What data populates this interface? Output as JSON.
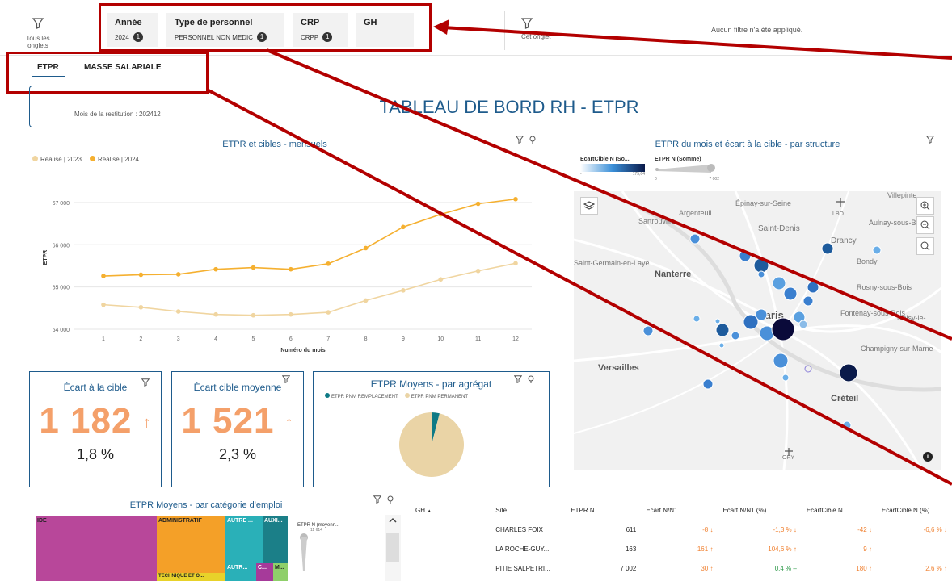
{
  "filters": {
    "all_tabs_label": "Tous les onglets",
    "chips": [
      {
        "title": "Année",
        "value": "2024",
        "count": "1"
      },
      {
        "title": "Type de personnel",
        "value": "PERSONNEL NON MEDIC",
        "count": "1"
      },
      {
        "title": "CRP",
        "value": "CRPP",
        "count": "1"
      },
      {
        "title": "GH",
        "value": "",
        "count": ""
      }
    ],
    "this_tab_label": "Cet onglet",
    "no_filter_text": "Aucun filtre n'a été appliqué."
  },
  "tabs": [
    {
      "label": "ETPR"
    },
    {
      "label": "MASSE SALARIALE"
    }
  ],
  "header": {
    "restitution": "Mois de la restitution : 202412",
    "title": "TABLEAU DE BORD RH - ETPR"
  },
  "line_panel": {
    "title": "ETPR et cibles - mensuels",
    "legend": [
      "Réalisé | 2023",
      "Réalisé | 2024"
    ],
    "colors": [
      "#f0d5a0",
      "#f5b030"
    ]
  },
  "chart_data": {
    "type": "line",
    "x": [
      1,
      2,
      3,
      4,
      5,
      6,
      7,
      8,
      9,
      10,
      11,
      12
    ],
    "series": [
      {
        "name": "Réalisé | 2023",
        "values": [
          64580,
          64520,
          64420,
          64350,
          64330,
          64350,
          64400,
          64680,
          64920,
          65180,
          65380,
          65560
        ]
      },
      {
        "name": "Réalisé | 2024",
        "values": [
          65260,
          65290,
          65300,
          65420,
          65460,
          65420,
          65550,
          65920,
          66420,
          66720,
          66970,
          67080
        ]
      }
    ],
    "xlabel": "Numéro du mois",
    "ylabel": "ETPR",
    "ylim": [
      64000,
      67400
    ],
    "yticks": [
      "64 000",
      "65 000",
      "66 000",
      "67 000"
    ],
    "ytick_values": [
      64000,
      65000,
      66000,
      67000
    ]
  },
  "map_panel": {
    "title": "ETPR du mois et écart à la cible - par structure",
    "legend_a": "EcartCible N (So...",
    "legend_a_min": "-",
    "legend_a_max": "175,64",
    "legend_b": "ETPR N (Somme)",
    "legend_b_min": "0",
    "legend_b_max": "7 002",
    "places": [
      "Villepinte",
      "Épinay-sur-Seine",
      "Argenteuil",
      "Saint-Denis",
      "Sartrouville",
      "Aulnay-sous-Bois",
      "Drancy",
      "Bondy",
      "Saint-Germain-en-Laye",
      "Nanterre",
      "Rosny-sous-Bois",
      "Paris",
      "Fontenay-sous-Bois",
      "Noisy-le-",
      "Champigny-sur-Marne",
      "Versailles",
      "Créteil",
      "LBO",
      "ORY"
    ]
  },
  "kpis": [
    {
      "title": "Écart à la cible",
      "value": "1 182",
      "arrow": "↑",
      "pct": "1,8 %"
    },
    {
      "title": "Écart cible moyenne",
      "value": "1 521",
      "arrow": "↑",
      "pct": "2,3 %"
    }
  ],
  "pie_panel": {
    "title": "ETPR Moyens - par agrégat",
    "legend": [
      "ETPR PNM REMPLACEMENT",
      "ETPR PNM PERMANENT"
    ],
    "colors": [
      "#0e7a85",
      "#ead4a6"
    ],
    "values": [
      4,
      96
    ]
  },
  "treemap_panel": {
    "title": "ETPR Moyens - par catégorie d'emploi",
    "labels": [
      "IDE",
      "ADMINISTRATIF",
      "AUTRE ...",
      "AUXI...",
      "TECHNIQUE ET O...",
      "AUTR...",
      "C...",
      "M..."
    ],
    "size_legend": "ETPR N (moyenn...",
    "size_max": "11 614"
  },
  "table": {
    "headers": [
      "GH",
      "Site",
      "ETPR N",
      "Ecart N/N1",
      "Ecart N/N1 (%)",
      "EcartCible N",
      "EcartCible N (%)"
    ],
    "rows": [
      {
        "site": "CHARLES FOIX",
        "etpr": "611",
        "ecart": "-8",
        "ecart_arrow": "↓",
        "ecart_pct": "-1,3 %",
        "ecart_pct_arrow": "↓",
        "cible": "-42",
        "cible_arrow": "↓",
        "cible_pct": "-6,6 %",
        "cible_pct_arrow": "↓"
      },
      {
        "site": "LA ROCHE-GUY...",
        "etpr": "163",
        "ecart": "161",
        "ecart_arrow": "↑",
        "ecart_pct": "104,6 %",
        "ecart_pct_arrow": "↑",
        "cible": "9",
        "cible_arrow": "↑",
        "cible_pct": "",
        "cible_pct_arrow": ""
      },
      {
        "site": "PITIE SALPETRI...",
        "etpr": "7 002",
        "ecart": "30",
        "ecart_arrow": "↑",
        "ecart_pct": "0,4 %",
        "ecart_pct_arrow": "–",
        "cible": "180",
        "cible_arrow": "↑",
        "cible_pct": "2,6 %",
        "cible_pct_arrow": "↑"
      }
    ]
  }
}
